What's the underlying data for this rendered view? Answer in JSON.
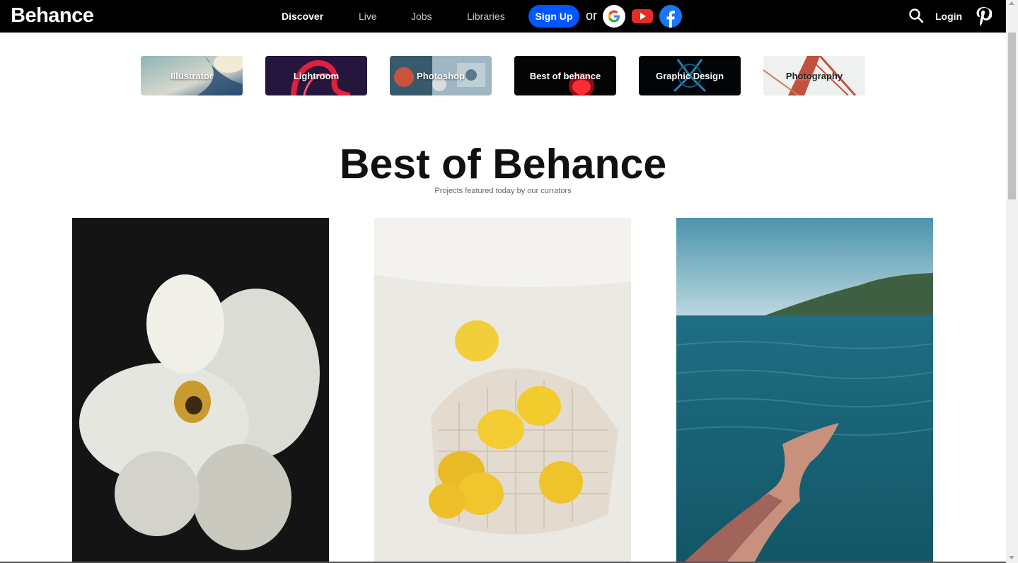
{
  "header": {
    "logo": "Behance",
    "nav": [
      "Discover",
      "Live",
      "Jobs",
      "Libraries"
    ],
    "signup_label": "Sign Up",
    "or_label": "or",
    "login_label": "Login"
  },
  "categories": [
    "Illustrator",
    "Lightroom",
    "Photoshop",
    "Best of behance",
    "Graphic Design",
    "Photography"
  ],
  "main": {
    "title": "Best of Behance",
    "subtitle": "Projects featured today by our currators"
  },
  "colors": {
    "topbar": "#000000",
    "signup": "#0057ff",
    "accent": "#0057ff"
  },
  "icons": {
    "google": "google-icon",
    "youtube": "youtube-icon",
    "facebook": "facebook-icon",
    "search": "search-icon",
    "pinterest": "pinterest-icon"
  }
}
